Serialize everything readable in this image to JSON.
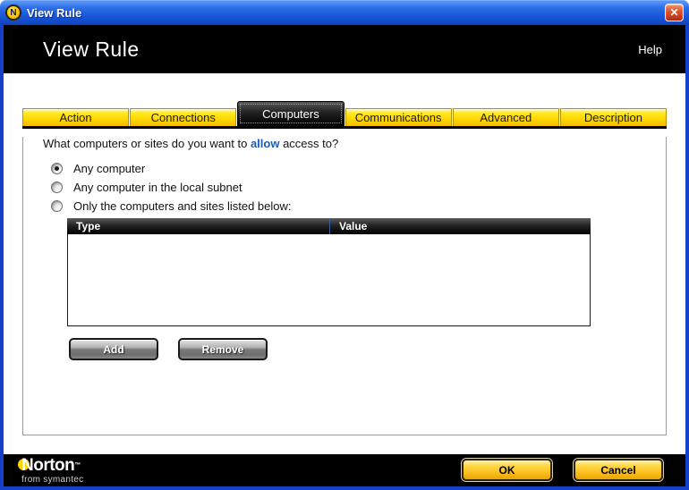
{
  "titlebar": {
    "title": "View Rule",
    "close_glyph": "✕",
    "icon_letter": "N"
  },
  "header": {
    "title": "View Rule",
    "help_label": "Help"
  },
  "tabs": [
    {
      "label": "Action",
      "active": false
    },
    {
      "label": "Connections",
      "active": false
    },
    {
      "label": "Computers",
      "active": true
    },
    {
      "label": "Communications",
      "active": false
    },
    {
      "label": "Advanced",
      "active": false
    },
    {
      "label": "Description",
      "active": false
    }
  ],
  "question": {
    "prefix": "What computers or sites do you want to ",
    "highlight": "allow",
    "suffix": " access to?"
  },
  "radios": [
    {
      "label": "Any computer",
      "selected": true
    },
    {
      "label": "Any computer in the local subnet",
      "selected": false
    },
    {
      "label": "Only the computers and sites listed below:",
      "selected": false
    }
  ],
  "table": {
    "columns": [
      "Type",
      "Value"
    ],
    "rows": []
  },
  "list_buttons": {
    "add": "Add",
    "remove": "Remove"
  },
  "footer": {
    "logo_title": "Norton",
    "logo_tm": "™",
    "logo_subtitle": "from symantec",
    "ok_label": "OK",
    "cancel_label": "Cancel"
  },
  "colors": {
    "accent_yellow": "#ffd900",
    "titlebar_blue": "#1a5adc",
    "window_border_blue": "#1441c8",
    "highlight_blue": "#1e5bb8",
    "header_black": "#000000"
  }
}
